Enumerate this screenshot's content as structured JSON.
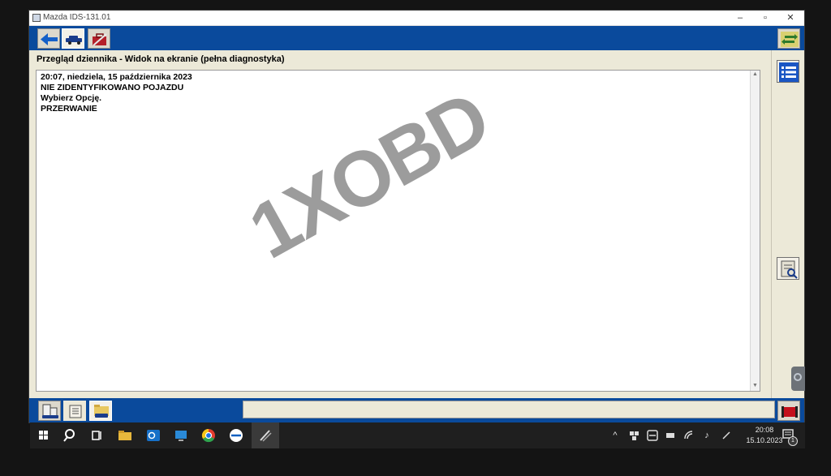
{
  "window": {
    "title": "Mazda IDS-131.01",
    "controls": {
      "minimize": "–",
      "maximize": "▫",
      "close": "✕"
    }
  },
  "toolbar": {
    "icons": [
      "back-arrow-icon",
      "vehicle-icon",
      "toolbox-icon",
      "swap-arrows-icon"
    ]
  },
  "header": {
    "title": "Przegląd dziennika - Widok na ekranie (pełna diagnostyka)"
  },
  "log": {
    "lines": [
      "20:07, niedziela, 15 października 2023",
      "NIE ZIDENTYFIKOWANO POJAZDU",
      "Wybierz Opcję.",
      "PRZERWANIE"
    ]
  },
  "watermark": {
    "text": "1XOBD"
  },
  "side_buttons": [
    "list-icon",
    "search-document-icon"
  ],
  "bottom_toolbar": {
    "icons": [
      "report-icon",
      "scroll-icon",
      "folder-vehicle-icon",
      "exit-icon"
    ],
    "status": ""
  },
  "taskbar": {
    "time": "20:08",
    "date": "15.10.2023",
    "notification_count": "1"
  },
  "colors": {
    "toolbar_blue": "#0a4a9c",
    "panel_bg": "#ece9d8",
    "taskbar_bg": "#1f1f1f"
  }
}
